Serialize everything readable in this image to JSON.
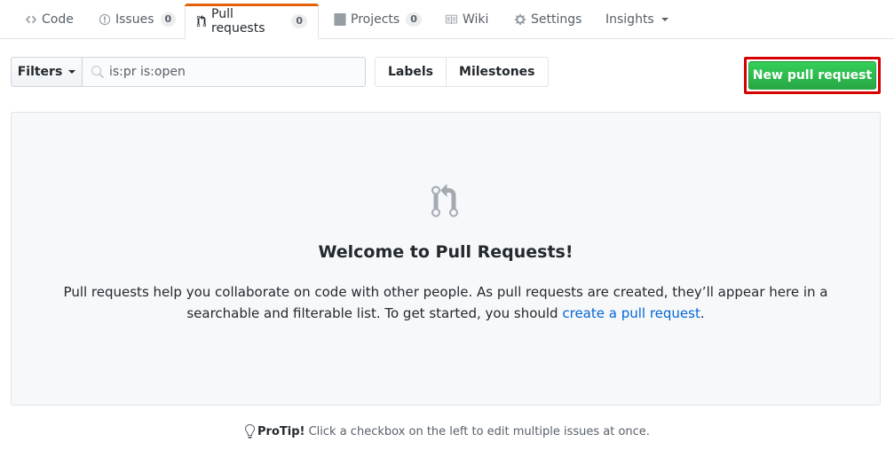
{
  "tabs": [
    {
      "label": "Code",
      "icon": "code-icon"
    },
    {
      "label": "Issues",
      "icon": "issue-opened-icon",
      "count": "0"
    },
    {
      "label": "Pull requests",
      "icon": "git-pull-request-icon",
      "count": "0",
      "selected": true
    },
    {
      "label": "Projects",
      "icon": "project-icon",
      "count": "0"
    },
    {
      "label": "Wiki",
      "icon": "book-icon"
    },
    {
      "label": "Settings",
      "icon": "gear-icon"
    },
    {
      "label": "Insights",
      "icon": "triangle-down-icon"
    }
  ],
  "subnav": {
    "filters_label": "Filters",
    "search_value": "is:pr is:open",
    "labels_label": "Labels",
    "milestones_label": "Milestones",
    "new_pr_label": "New pull request"
  },
  "blankslate": {
    "title": "Welcome to Pull Requests!",
    "text_before": "Pull requests help you collaborate on code with other people. As pull requests are created, they’ll appear here in a searchable and filterable list. To get started, you should ",
    "link": "create a pull request",
    "text_after": "."
  },
  "protip": {
    "label": "ProTip!",
    "text": " Click a checkbox on the left to edit multiple issues at once."
  },
  "colors": {
    "accent_tab": "#e36209",
    "link": "#0366d6",
    "primary_button": "#28a745",
    "highlight_box": "#d60000"
  }
}
